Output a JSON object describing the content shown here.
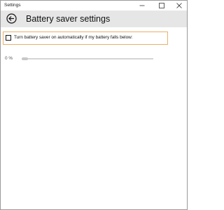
{
  "window": {
    "title": "Settings",
    "controls": {
      "minimize_icon": "minimize-icon",
      "maximize_icon": "maximize-icon",
      "close_icon": "close-icon"
    }
  },
  "header": {
    "back_icon": "back-arrow-icon",
    "title": "Battery saver settings"
  },
  "battery_saver": {
    "auto_checkbox_label": "Turn battery saver on automatically if my battery falls below:",
    "auto_checkbox_checked": false,
    "threshold_display": "0 %",
    "threshold_value_percent": 0
  },
  "colors": {
    "header_bg": "#e6e6e6",
    "focus_border": "#e8b068",
    "slider_track": "#d4d4d4"
  }
}
